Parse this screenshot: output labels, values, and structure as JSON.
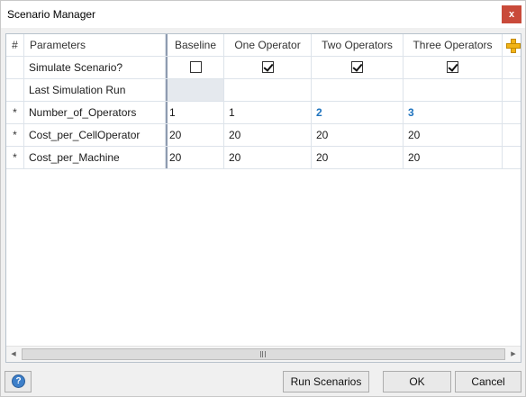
{
  "window": {
    "title": "Scenario Manager",
    "close_label": "x"
  },
  "grid": {
    "headers": {
      "hash": "#",
      "parameters": "Parameters",
      "baseline": "Baseline",
      "one": "One Operator",
      "two": "Two Operators",
      "three": "Three Operators"
    },
    "rows": {
      "simulate": {
        "label": "Simulate Scenario?",
        "baseline_checked": false,
        "one_checked": true,
        "two_checked": true,
        "three_checked": true
      },
      "last_run": {
        "label": "Last Simulation Run"
      },
      "operators": {
        "marker": "*",
        "label": "Number_of_Operators",
        "baseline": "1",
        "one": "1",
        "two": "2",
        "three": "3"
      },
      "cell_operator": {
        "marker": "*",
        "label": "Cost_per_CellOperator",
        "baseline": "20",
        "one": "20",
        "two": "20",
        "three": "20"
      },
      "machine": {
        "marker": "*",
        "label": "Cost_per_Machine",
        "baseline": "20",
        "one": "20",
        "two": "20",
        "three": "20"
      }
    },
    "modified_value_color": "#1e73be",
    "add_icon": "plus-icon"
  },
  "scrollbar": {
    "left_arrow": "◀",
    "right_arrow": "▶"
  },
  "footer": {
    "help_glyph": "?",
    "run_label": "Run Scenarios",
    "ok_label": "OK",
    "cancel_label": "Cancel"
  }
}
